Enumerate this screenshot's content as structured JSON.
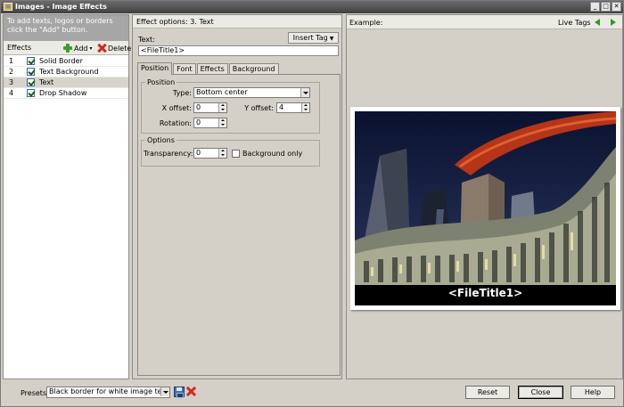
{
  "window": {
    "title": "Images - Image Effects",
    "controls": [
      "_",
      "□",
      "✕"
    ]
  },
  "left": {
    "hint": "To add texts, logos or borders click the \"Add\" button.",
    "header_label": "Effects",
    "add_label": "Add",
    "delete_label": "Delete",
    "effects": [
      {
        "num": "1",
        "name": "Solid Border",
        "checked": true,
        "selected": false
      },
      {
        "num": "2",
        "name": "Text Background",
        "checked": true,
        "selected": false
      },
      {
        "num": "3",
        "name": "Text",
        "checked": true,
        "selected": true
      },
      {
        "num": "4",
        "name": "Drop Shadow",
        "checked": true,
        "selected": false
      }
    ]
  },
  "middle": {
    "header": "Effect options: 3. Text",
    "text_label": "Text:",
    "insert_tag_label": "Insert Tag",
    "text_value": "<FileTitle1>",
    "tabs": [
      "Position",
      "Font",
      "Effects",
      "Background"
    ],
    "active_tab": "Position",
    "position_group": {
      "title": "Position",
      "type_label": "Type:",
      "type_value": "Bottom center",
      "x_offset_label": "X offset:",
      "x_offset_value": "0",
      "y_offset_label": "Y offset:",
      "y_offset_value": "4",
      "rotation_label": "Rotation:",
      "rotation_value": "0"
    },
    "options_group": {
      "title": "Options",
      "transparency_label": "Transparency:",
      "transparency_value": "0",
      "background_only_label": "Background only",
      "background_only_checked": false
    }
  },
  "right": {
    "example_label": "Example:",
    "live_tags_label": "Live Tags",
    "preview_caption": "<FileTitle1>"
  },
  "bottom": {
    "presets_label": "Presets:",
    "preset_value": "Black border for white image text",
    "reset_label": "Reset",
    "close_label": "Close",
    "help_label": "Help"
  },
  "colors": {
    "nav_arrow": "#2f9a2a",
    "add_icon": "#3aa02c",
    "delete_icon": "#d32a1a"
  }
}
